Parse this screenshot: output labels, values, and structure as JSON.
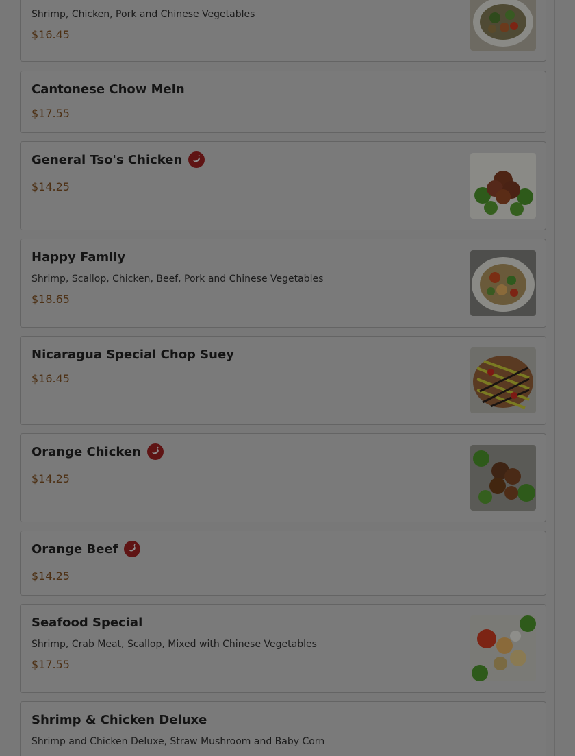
{
  "menu": {
    "items": [
      {
        "name": "",
        "description": "Shrimp, Chicken, Pork and Chinese Vegetables",
        "price": "$16.45",
        "spicy": false,
        "has_image": true,
        "image_icon": "mixed-vegetables-dish-photo"
      },
      {
        "name": "Cantonese Chow Mein",
        "description": "",
        "price": "$17.55",
        "spicy": false,
        "has_image": false
      },
      {
        "name": "General Tso's Chicken",
        "description": "",
        "price": "$14.25",
        "spicy": true,
        "has_image": true,
        "image_icon": "chicken-broccoli-dish-photo"
      },
      {
        "name": "Happy Family",
        "description": "Shrimp, Scallop, Chicken, Beef, Pork and Chinese Vegetables",
        "price": "$18.65",
        "spicy": false,
        "has_image": true,
        "image_icon": "stir-fry-bowl-photo"
      },
      {
        "name": "Nicaragua Special Chop Suey",
        "description": "",
        "price": "$16.45",
        "spicy": false,
        "has_image": true,
        "image_icon": "chop-suey-sauce-photo"
      },
      {
        "name": "Orange Chicken",
        "description": "",
        "price": "$14.25",
        "spicy": true,
        "has_image": true,
        "image_icon": "orange-chicken-photo"
      },
      {
        "name": "Orange Beef",
        "description": "",
        "price": "$14.25",
        "spicy": true,
        "has_image": false
      },
      {
        "name": "Seafood Special",
        "description": "Shrimp, Crab Meat, Scallop, Mixed with Chinese Vegetables",
        "price": "$17.55",
        "spicy": false,
        "has_image": true,
        "image_icon": "seafood-plate-photo"
      },
      {
        "name": "Shrimp & Chicken Deluxe",
        "description": "Shrimp and Chicken Deluxe, Straw Mushroom and Baby Corn",
        "price": "",
        "spicy": false,
        "has_image": false
      }
    ]
  },
  "icons": {
    "spicy": "chili-pepper-icon"
  },
  "colors": {
    "overlay_background": "#787878",
    "price_text": "#4d3014",
    "spicy_badge": "#5f1414"
  }
}
